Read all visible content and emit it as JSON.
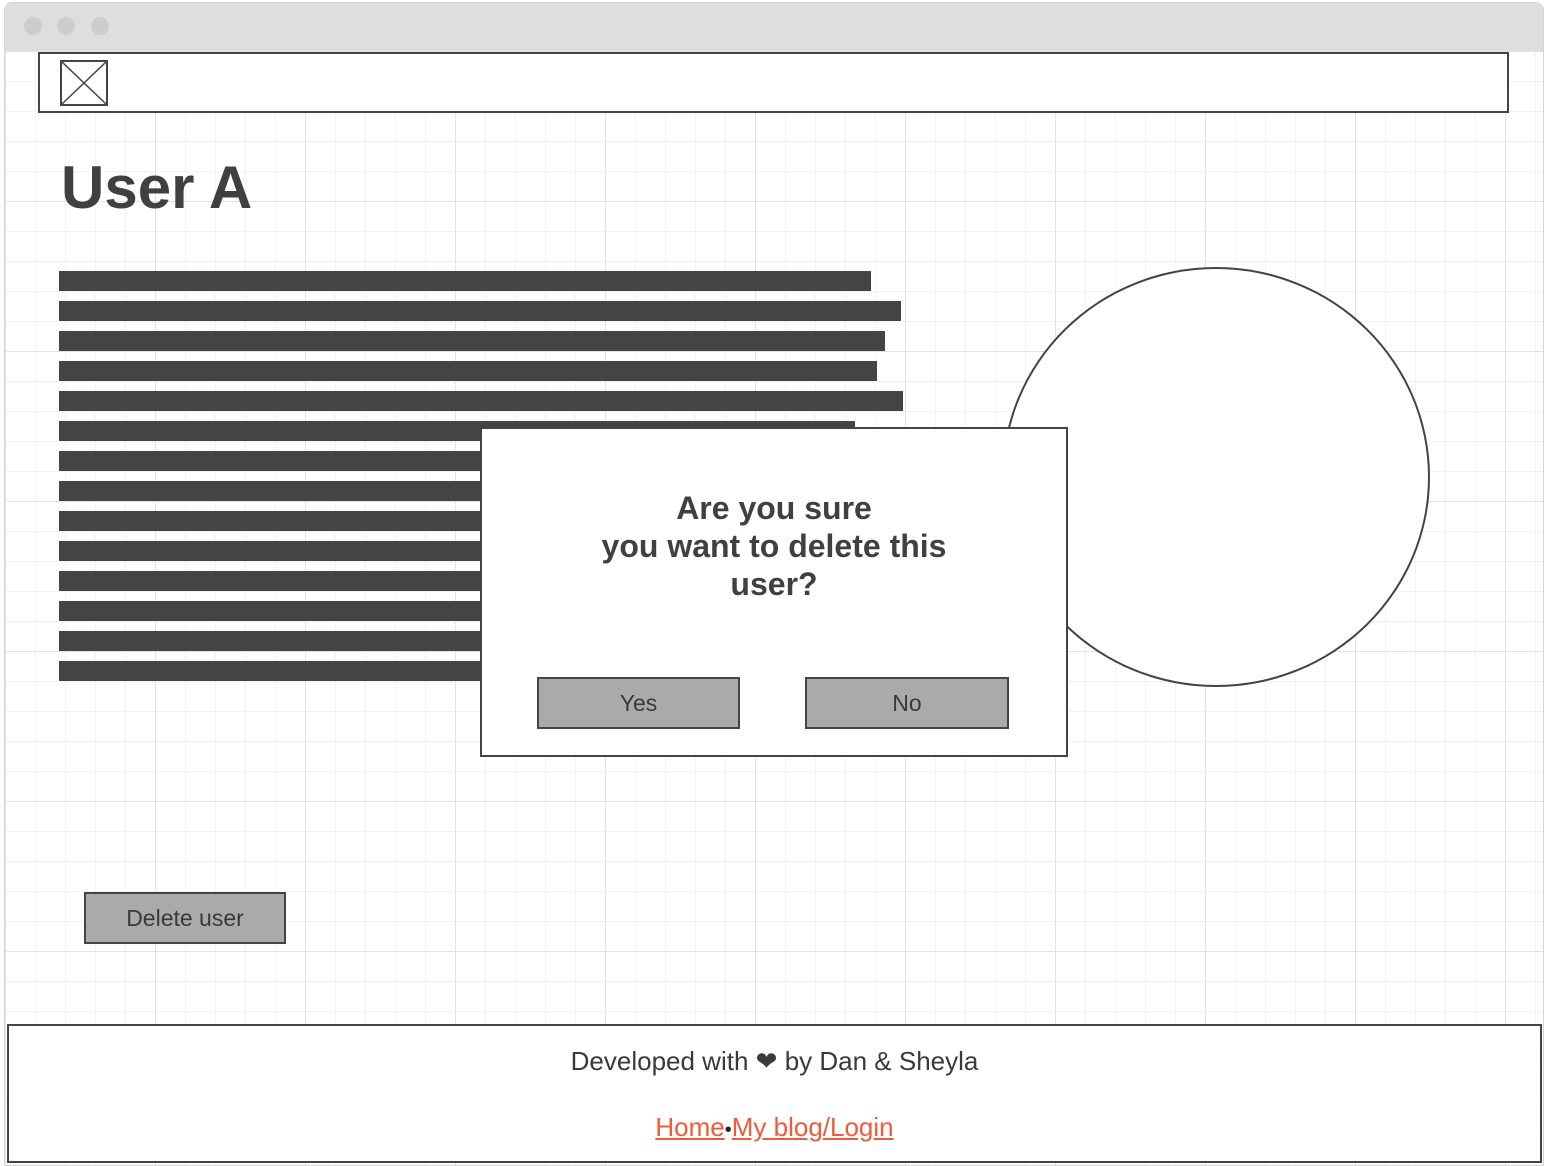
{
  "window": {
    "controls": [
      "close-dot",
      "minimize-dot",
      "maximize-dot"
    ]
  },
  "header": {
    "logo_icon": "image-placeholder-icon"
  },
  "main": {
    "title": "User A",
    "delete_button_label": "Delete user",
    "text_line_count": 14
  },
  "dialog": {
    "message": "Are you sure\nyou want to delete this\nuser?",
    "yes_label": "Yes",
    "no_label": "No"
  },
  "footer": {
    "credit_prefix": "Developed with",
    "credit_icon": "❤",
    "credit_suffix": "by Dan & Sheyla",
    "links": [
      {
        "label": "Home"
      },
      {
        "label": "My blog/Login"
      }
    ],
    "separator": "•",
    "link_color": "#ef5a3c"
  }
}
